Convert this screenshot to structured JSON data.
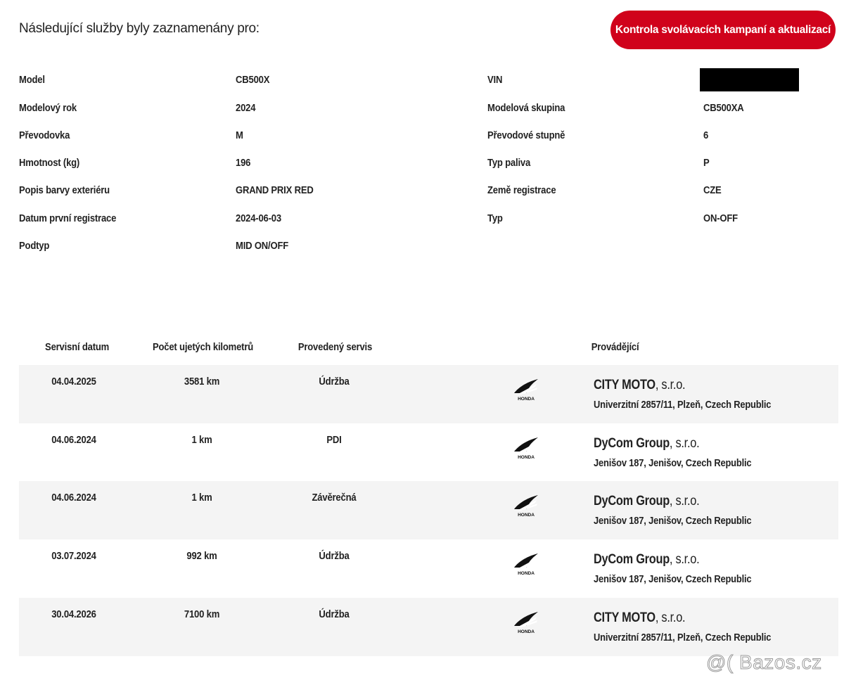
{
  "header": {
    "intro": "Následující služby byly zaznamenány pro:",
    "recall_button": "Kontrola svolávacích kampaní a aktualizací"
  },
  "specs": {
    "left": [
      {
        "label": "Model",
        "value": "CB500X"
      },
      {
        "label": "Modelový rok",
        "value": "2024"
      },
      {
        "label": "Převodovka",
        "value": "M"
      },
      {
        "label": "Hmotnost (kg)",
        "value": "196"
      },
      {
        "label": "Popis barvy exteriéru",
        "value": "GRAND PRIX RED"
      },
      {
        "label": "Datum první registrace",
        "value": "2024-06-03"
      },
      {
        "label": "Podtyp",
        "value": "MID ON/OFF"
      }
    ],
    "right": [
      {
        "label": "VIN",
        "value": ""
      },
      {
        "label": "Modelová skupina",
        "value": "CB500XA"
      },
      {
        "label": "Převodové stupně",
        "value": "6"
      },
      {
        "label": "Typ paliva",
        "value": "P"
      },
      {
        "label": "Země registrace",
        "value": "CZE"
      },
      {
        "label": "Typ",
        "value": "ON-OFF"
      }
    ]
  },
  "table": {
    "headers": {
      "date": "Servisní datum",
      "km": "Počet ujetých kilometrů",
      "service": "Provedený servis",
      "dealer": "Provádějící"
    },
    "rows": [
      {
        "date": "04.04.2025",
        "km": "3581 km",
        "service": "Údržba",
        "dealer_name": "CITY MOTO",
        "dealer_suffix": ", s.r.o.",
        "address": "Univerzitní 2857/11, Plzeň, Czech Republic"
      },
      {
        "date": "04.06.2024",
        "km": "1 km",
        "service": "PDI",
        "dealer_name": "DyCom Group",
        "dealer_suffix": ", s.r.o.",
        "address": "Jenišov 187, Jenišov, Czech Republic"
      },
      {
        "date": "04.06.2024",
        "km": "1 km",
        "service": "Závěrečná",
        "dealer_name": "DyCom Group",
        "dealer_suffix": ", s.r.o.",
        "address": "Jenišov 187, Jenišov, Czech Republic"
      },
      {
        "date": "03.07.2024",
        "km": "992 km",
        "service": "Údržba",
        "dealer_name": "DyCom Group",
        "dealer_suffix": ", s.r.o.",
        "address": "Jenišov 187, Jenišov, Czech Republic"
      },
      {
        "date": "30.04.2026",
        "km": "7100 km",
        "service": "Údržba",
        "dealer_name": "CITY MOTO",
        "dealer_suffix": ", s.r.o.",
        "address": "Univerzitní 2857/11, Plzeň, Czech Republic"
      }
    ],
    "logo_icon": "honda-wing-icon",
    "logo_text": "HONDA"
  },
  "watermark": "@( Bazos.cz",
  "colors": {
    "accent": "#d0021b",
    "row_shade": "#f4f4f4"
  }
}
